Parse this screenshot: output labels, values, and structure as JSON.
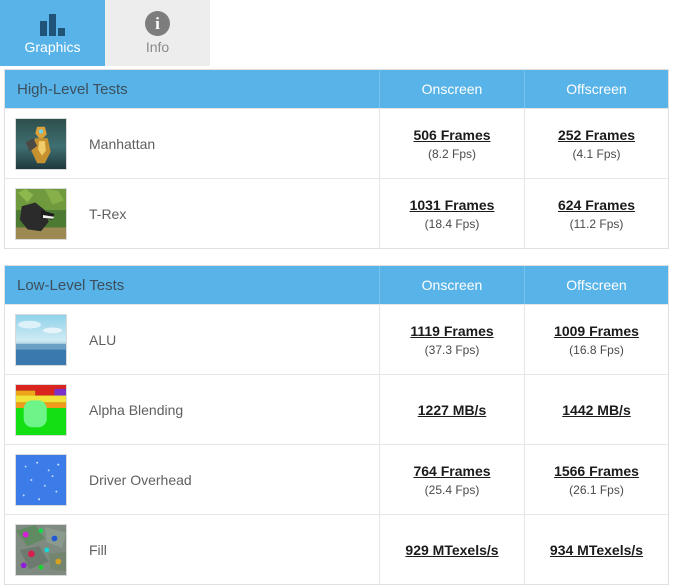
{
  "tabs": [
    {
      "label": "Graphics",
      "icon": "bar-chart-icon",
      "active": true
    },
    {
      "label": "Info",
      "icon": "info-circle-icon",
      "active": false
    }
  ],
  "colors": {
    "accent_blue": "#57b3e8",
    "tab_inactive": "#ededed",
    "header_title_text": "#3d4f5c",
    "header_col_text": "#ffffff",
    "row_border": "#e6e6e6",
    "value_text": "#1b1b1b",
    "subvalue_text": "#4a4a4a",
    "name_text": "#5f5f5f",
    "icon_navy": "#1f5478",
    "info_gray": "#7d7d7d"
  },
  "tables": [
    {
      "id": "high-level-tests",
      "title": "High-Level Tests",
      "columns": [
        "Onscreen",
        "Offscreen"
      ],
      "rows": [
        {
          "name": "Manhattan",
          "thumb": "manhattan-thumbnail",
          "onscreen": {
            "main": "506 Frames",
            "sub": "(8.2 Fps)"
          },
          "offscreen": {
            "main": "252 Frames",
            "sub": "(4.1 Fps)"
          }
        },
        {
          "name": "T-Rex",
          "thumb": "trex-thumbnail",
          "onscreen": {
            "main": "1031 Frames",
            "sub": "(18.4 Fps)"
          },
          "offscreen": {
            "main": "624 Frames",
            "sub": "(11.2 Fps)"
          }
        }
      ]
    },
    {
      "id": "low-level-tests",
      "title": "Low-Level Tests",
      "columns": [
        "Onscreen",
        "Offscreen"
      ],
      "rows": [
        {
          "name": "ALU",
          "thumb": "alu-thumbnail",
          "onscreen": {
            "main": "1119 Frames",
            "sub": "(37.3 Fps)"
          },
          "offscreen": {
            "main": "1009 Frames",
            "sub": "(16.8 Fps)"
          }
        },
        {
          "name": "Alpha Blending",
          "thumb": "alpha-blending-thumbnail",
          "onscreen": {
            "main": "1227 MB/s",
            "sub": ""
          },
          "offscreen": {
            "main": "1442 MB/s",
            "sub": ""
          }
        },
        {
          "name": "Driver Overhead",
          "thumb": "driver-overhead-thumbnail",
          "onscreen": {
            "main": "764 Frames",
            "sub": "(25.4 Fps)"
          },
          "offscreen": {
            "main": "1566 Frames",
            "sub": "(26.1 Fps)"
          }
        },
        {
          "name": "Fill",
          "thumb": "fill-thumbnail",
          "onscreen": {
            "main": "929 MTexels/s",
            "sub": ""
          },
          "offscreen": {
            "main": "934 MTexels/s",
            "sub": ""
          }
        }
      ]
    }
  ]
}
